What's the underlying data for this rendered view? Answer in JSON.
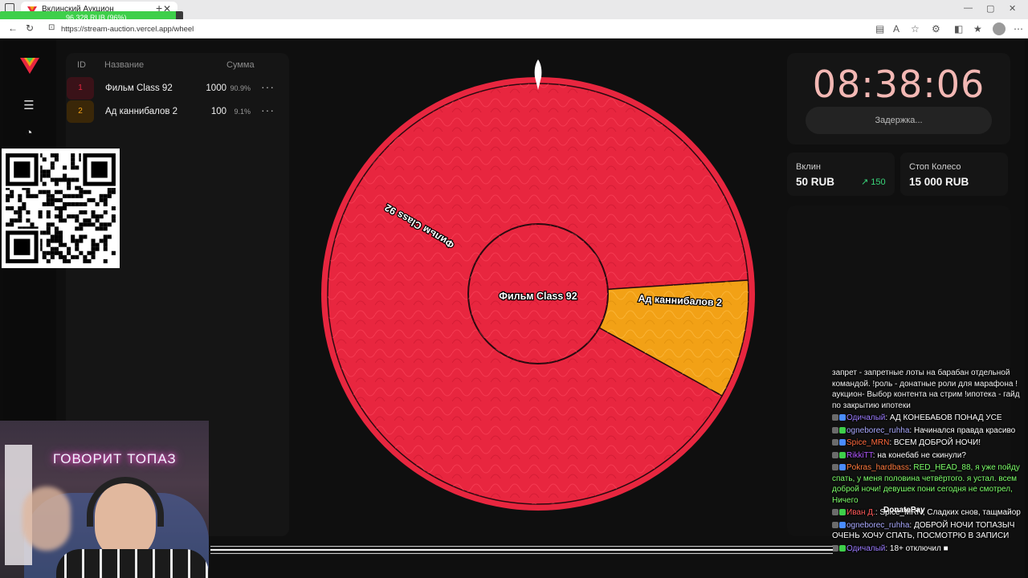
{
  "browser": {
    "tab_title": "Вклинский Аукцион",
    "url": "https://stream-auction.vercel.app/wheel",
    "progress_text": "96 328 RUB (96%)",
    "progress_fraction": 0.96
  },
  "lots": {
    "headers": {
      "id": "ID",
      "name": "Название",
      "amount": "Сумма"
    },
    "rows": [
      {
        "id": "1",
        "name": "Фильм Class 92",
        "amount": "1000",
        "pct": "90.9%",
        "color": "#e8263f"
      },
      {
        "id": "2",
        "name": "Ад каннибалов 2",
        "amount": "100",
        "pct": "9.1%",
        "color": "#f2a116"
      }
    ]
  },
  "wheel": {
    "center_label": "Фильм Class 92",
    "segments": [
      {
        "label": "Фильм Class 92",
        "value": 1000,
        "color": "#e8263f"
      },
      {
        "label": "Ад каннибалов 2",
        "value": 100,
        "color": "#f2a116"
      }
    ],
    "rim_color": "#e8263f"
  },
  "timer": {
    "time": "08:38:06",
    "delay_label": "Задержка..."
  },
  "stats": {
    "vklin_label": "Вклин",
    "vklin_value": "50 RUB",
    "vklin_delta": "150",
    "stop_label": "Стоп Колесо",
    "stop_value": "15 000 RUB"
  },
  "chat": {
    "intro": "запрет - запретные лоты на барабан отдельной командой. !роль - донатные роли для марафона !аукцион- Выбор контента на стрим !ипотека - гайд по закрытию ипотеки",
    "messages": [
      {
        "user": "Одичалый",
        "text": "АД КОНЕБАБОВ ПОНАД УСЕ",
        "user_color": "#9b7bff",
        "text_color": "#ffffff"
      },
      {
        "user": "ogneborec_ruhha",
        "text": "Начинался правда красиво",
        "user_color": "#a9a9ff",
        "text_color": "#ffffff"
      },
      {
        "user": "Spice_MRN",
        "text": "ВСЕМ ДОБРОЙ НОЧИ!",
        "user_color": "#ff6a3d",
        "text_color": "#ffffff"
      },
      {
        "user": "RikkiTT",
        "text": "на конебаб не скинули?",
        "user_color": "#b056ff",
        "text_color": "#ffffff"
      },
      {
        "user": "Pokras_hardbass",
        "text": "RED_HEAD_88, я уже пойду спать, у меня половина четвёртого. я устал. всем доброй ночи! девушек пони сегодня не смотрел, Ничего",
        "user_color": "#ff7a3d",
        "text_color": "#7dff6a"
      },
      {
        "user": "Иван Д.",
        "text": "Spice_MRN, Сладких снов, тащмайор",
        "user_color": "#ff5a5a",
        "text_color": "#ffffff"
      },
      {
        "user": "ogneborec_ruhha",
        "text": "ДОБРОЙ НОЧИ ТОПАЗЫЧ ОЧЕНЬ ХОЧУ СПАТЬ, ПОСМОТРЮ В ЗАПИСИ",
        "user_color": "#a9a9ff",
        "text_color": "#ffffff"
      },
      {
        "user": "Одичалый",
        "text": "18+ отключил ■",
        "user_color": "#9b7bff",
        "text_color": "#ffffff"
      }
    ],
    "donate_label": "DonatePay"
  },
  "webcam": {
    "neon_text": "ГОВОРИТ ТОПАЗ"
  }
}
